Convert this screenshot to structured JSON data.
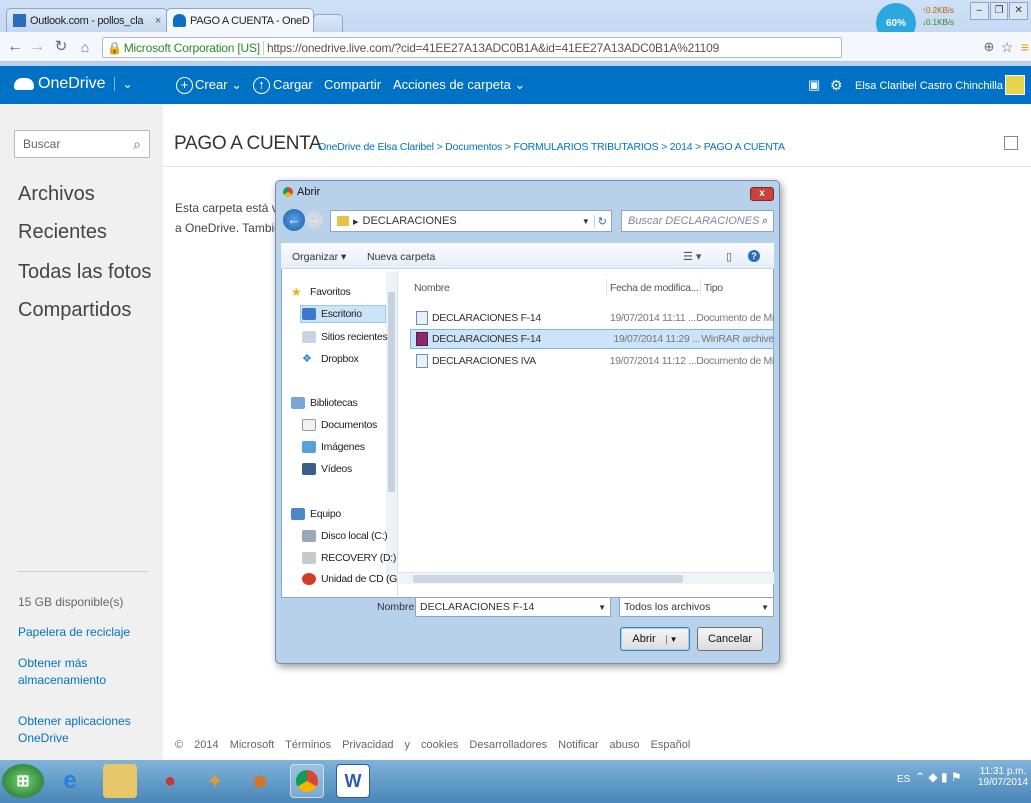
{
  "browser": {
    "tabs": [
      {
        "label": "Outlook.com - pollos_cla",
        "close": "×"
      },
      {
        "label": "PAGO A CUENTA - OneD",
        "close": "×"
      }
    ],
    "url_identity": "Microsoft Corporation [US]",
    "url": "https://onedrive.live.com/?cid=41EE27A13ADC0B1A&id=41EE27A13ADC0B1A%21109",
    "net_widget": {
      "percent": "60%",
      "up": "0.2KB/s",
      "down": "0.1KB/s"
    }
  },
  "onedrive": {
    "brand": "OneDrive",
    "menu": {
      "crear": "Crear",
      "cargar": "Cargar",
      "compartir": "Compartir",
      "acciones": "Acciones de carpeta"
    },
    "user": "Elsa Claribel Castro Chinchilla",
    "search_placeholder": "Buscar",
    "nav": [
      "Archivos",
      "Recientes",
      "Todas las fotos",
      "Compartidos"
    ],
    "storage": "15 GB disponible(s)",
    "recycle": "Papelera de reciclaje",
    "more_storage": "Obtener más almacenamiento",
    "apps": "Obtener aplicaciones OneDrive",
    "page_title": "PAGO A CUENTA",
    "breadcrumb": "OneDrive de Elsa Claribel  >  Documentos  >  FORMULARIOS TRIBUTARIOS  >  2014  >  PAGO A CUENTA",
    "empty_line1": "Esta carpeta está va",
    "empty_line2": "a OneDrive. Tambié",
    "footer": [
      "© 2014 Microsoft",
      "Términos",
      "Privacidad y cookies",
      "Desarrolladores",
      "Notificar abuso",
      "Español"
    ]
  },
  "dialog": {
    "title": "Abrir",
    "close": "x",
    "path": "DECLARACIONES",
    "search_placeholder": "Buscar DECLARACIONES",
    "organize": "Organizar ▾",
    "new_folder": "Nueva carpeta",
    "tree": {
      "favorites": "Favoritos",
      "desktop": "Escritorio",
      "recent": "Sitios recientes",
      "dropbox": "Dropbox",
      "libraries": "Bibliotecas",
      "documents": "Documentos",
      "images": "Imágenes",
      "videos": "Vídeos",
      "computer": "Equipo",
      "disk_c": "Disco local (C:)",
      "recovery": "RECOVERY (D:)",
      "cd": "Unidad de CD (G"
    },
    "columns": {
      "name": "Nombre",
      "date": "Fecha de modifica...",
      "type": "Tipo"
    },
    "files": [
      {
        "name": "DECLARACIONES F-14",
        "date": "19/07/2014 11:11 ...",
        "type": "Documento de Mi"
      },
      {
        "name": "DECLARACIONES F-14",
        "date": "19/07/2014 11:29 ...",
        "type": "WinRAR archive"
      },
      {
        "name": "DECLARACIONES IVA",
        "date": "19/07/2014 11:12 ...",
        "type": "Documento de Mi"
      }
    ],
    "filename_label": "Nombre:",
    "filename_value": "DECLARACIONES F-14",
    "filter": "Todos los archivos",
    "open": "Abrir",
    "cancel": "Cancelar"
  },
  "taskbar": {
    "lang": "ES",
    "time": "11:31 p.m.",
    "date": "19/07/2014"
  }
}
